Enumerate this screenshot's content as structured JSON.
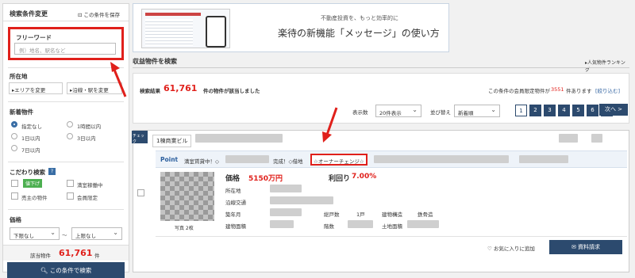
{
  "sidebar": {
    "title": "検索条件変更",
    "save_condition": "この条件を保存",
    "freeword": {
      "label": "フリーワード",
      "placeholder": "例）地名、駅名など"
    },
    "location": {
      "label": "所在地",
      "area_button": "エリアを変更",
      "line_button": "沿線・駅を変更"
    },
    "new_listing": {
      "label": "新着物件",
      "options": [
        "指定なし",
        "1時間以内",
        "1日以内",
        "3日以内",
        "7日以内"
      ],
      "selected": "指定なし"
    },
    "preference": {
      "label": "こだわり検索",
      "help": "?",
      "items": [
        "値下げ",
        "満室稼働中",
        "売主の物件",
        "会員限定"
      ]
    },
    "price": {
      "label": "価格",
      "min": "下限なし",
      "separator": "〜",
      "max": "上限なし"
    },
    "count": {
      "label": "該当物件",
      "value": "61,761",
      "unit": "件"
    },
    "search_button": "この条件で検索"
  },
  "banner": {
    "sub": "不動産投資を、もっと効率的に",
    "main": "楽待の新機能「メッセージ」の使い方"
  },
  "main": {
    "title": "収益物件を検索",
    "ranking": "人気物件ランキング",
    "result": {
      "prefix": "検索結果",
      "count": "61,761",
      "suffix": "件の物件が該当しました"
    },
    "members_note": {
      "prefix": "この条件の会員限定物件が",
      "count": "3551",
      "suffix": "件あります",
      "link": "[絞り込む]"
    },
    "display_count": {
      "label": "表示数",
      "value": "20件表示"
    },
    "sort": {
      "label": "並び替え",
      "value": "新着順"
    },
    "pagination": [
      "1",
      "2",
      "3",
      "4",
      "5",
      "6",
      "7",
      "次へ >"
    ]
  },
  "card": {
    "check_badge": "チェック",
    "type": "1棟商業ビル",
    "point_label": "Point",
    "point_text": "満室賃貸中！◇",
    "point_text2": "完成！◇借地",
    "owner_change": "☆オーナーチェンジ☆",
    "photo_caption": "写真 2枚",
    "price_label": "価格",
    "price_value": "5150万円",
    "yield_label": "利回り",
    "yield_value": "7.00%",
    "fields": {
      "address": "所在地",
      "transport": "沿線交通",
      "built": "築年月",
      "units": "総戸数",
      "units_value": "1戸",
      "structure": "建物構造",
      "structure_value": "鉄骨造",
      "building_area": "建物面積",
      "floors": "階数",
      "land_area": "土地面積"
    },
    "favorite": "お気に入りに追加",
    "request": "資料請求"
  },
  "colors": {
    "accent": "#e0201b",
    "navy": "#2c4a6e",
    "highlight": "#e0201b"
  }
}
